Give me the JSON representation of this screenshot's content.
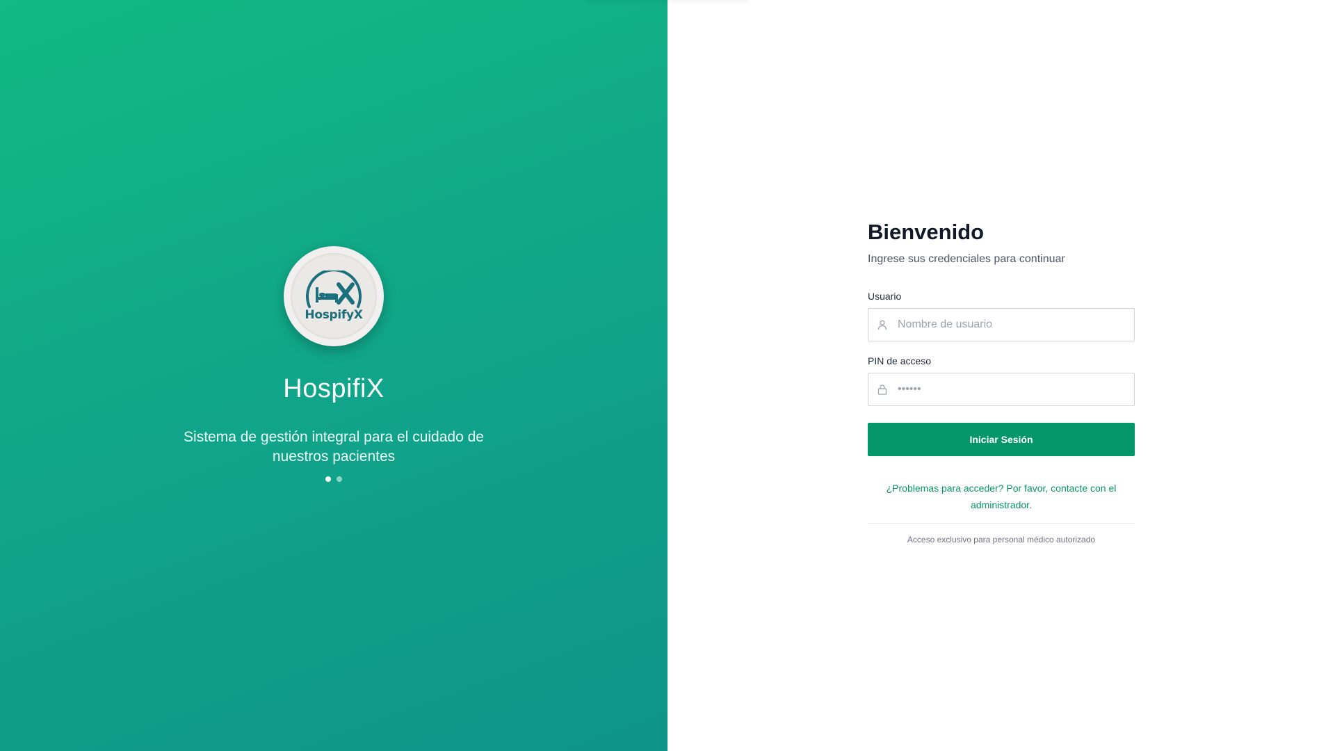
{
  "hero": {
    "logo_text": "HospifyX",
    "app_name": "HospifiX",
    "tagline": "Sistema de gestión integral para el cuidado de nuestros pacientes",
    "carousel": {
      "total": 2,
      "active_index": 0
    },
    "gradient_colors": [
      "#12b981",
      "#0e9488"
    ]
  },
  "form": {
    "title": "Bienvenido",
    "subtitle": "Ingrese sus credenciales para continuar",
    "username": {
      "label": "Usuario",
      "placeholder": "Nombre de usuario",
      "icon": "user-icon"
    },
    "pin": {
      "label": "PIN de acceso",
      "placeholder": "••••••",
      "icon": "lock-icon"
    },
    "submit_label": "Iniciar Sesión",
    "help_text": "¿Problemas para acceder? Por favor, contacte con el administrador.",
    "footnote": "Acceso exclusivo para personal médico autorizado",
    "accent_color": "#059669"
  }
}
